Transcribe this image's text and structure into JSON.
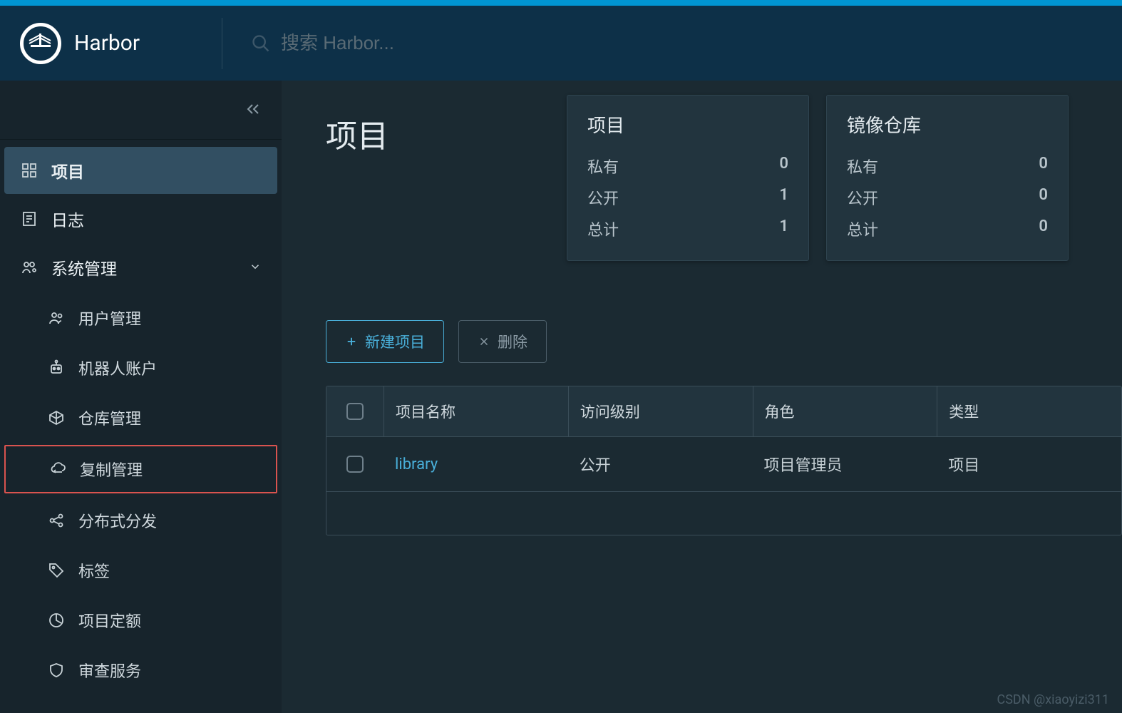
{
  "header": {
    "app_name": "Harbor",
    "search_placeholder": "搜索 Harbor..."
  },
  "sidebar": {
    "projects": "项目",
    "logs": "日志",
    "admin": "系统管理",
    "items": {
      "users": "用户管理",
      "robots": "机器人账户",
      "registries": "仓库管理",
      "replication": "复制管理",
      "distribution": "分布式分发",
      "labels": "标签",
      "quotas": "项目定额",
      "interrogation": "审查服务"
    }
  },
  "page": {
    "title": "项目",
    "stats": {
      "projects": {
        "title": "项目",
        "private_label": "私有",
        "private_value": "0",
        "public_label": "公开",
        "public_value": "1",
        "total_label": "总计",
        "total_value": "1"
      },
      "repos": {
        "title": "镜像仓库",
        "private_label": "私有",
        "private_value": "0",
        "public_label": "公开",
        "public_value": "0",
        "total_label": "总计",
        "total_value": "0"
      }
    },
    "actions": {
      "new_project": "新建项目",
      "delete": "删除"
    },
    "table": {
      "headers": {
        "name": "项目名称",
        "access": "访问级别",
        "role": "角色",
        "type": "类型"
      },
      "rows": [
        {
          "name": "library",
          "access": "公开",
          "role": "项目管理员",
          "type": "项目"
        }
      ]
    }
  },
  "watermark": "CSDN @xiaoyizi311"
}
